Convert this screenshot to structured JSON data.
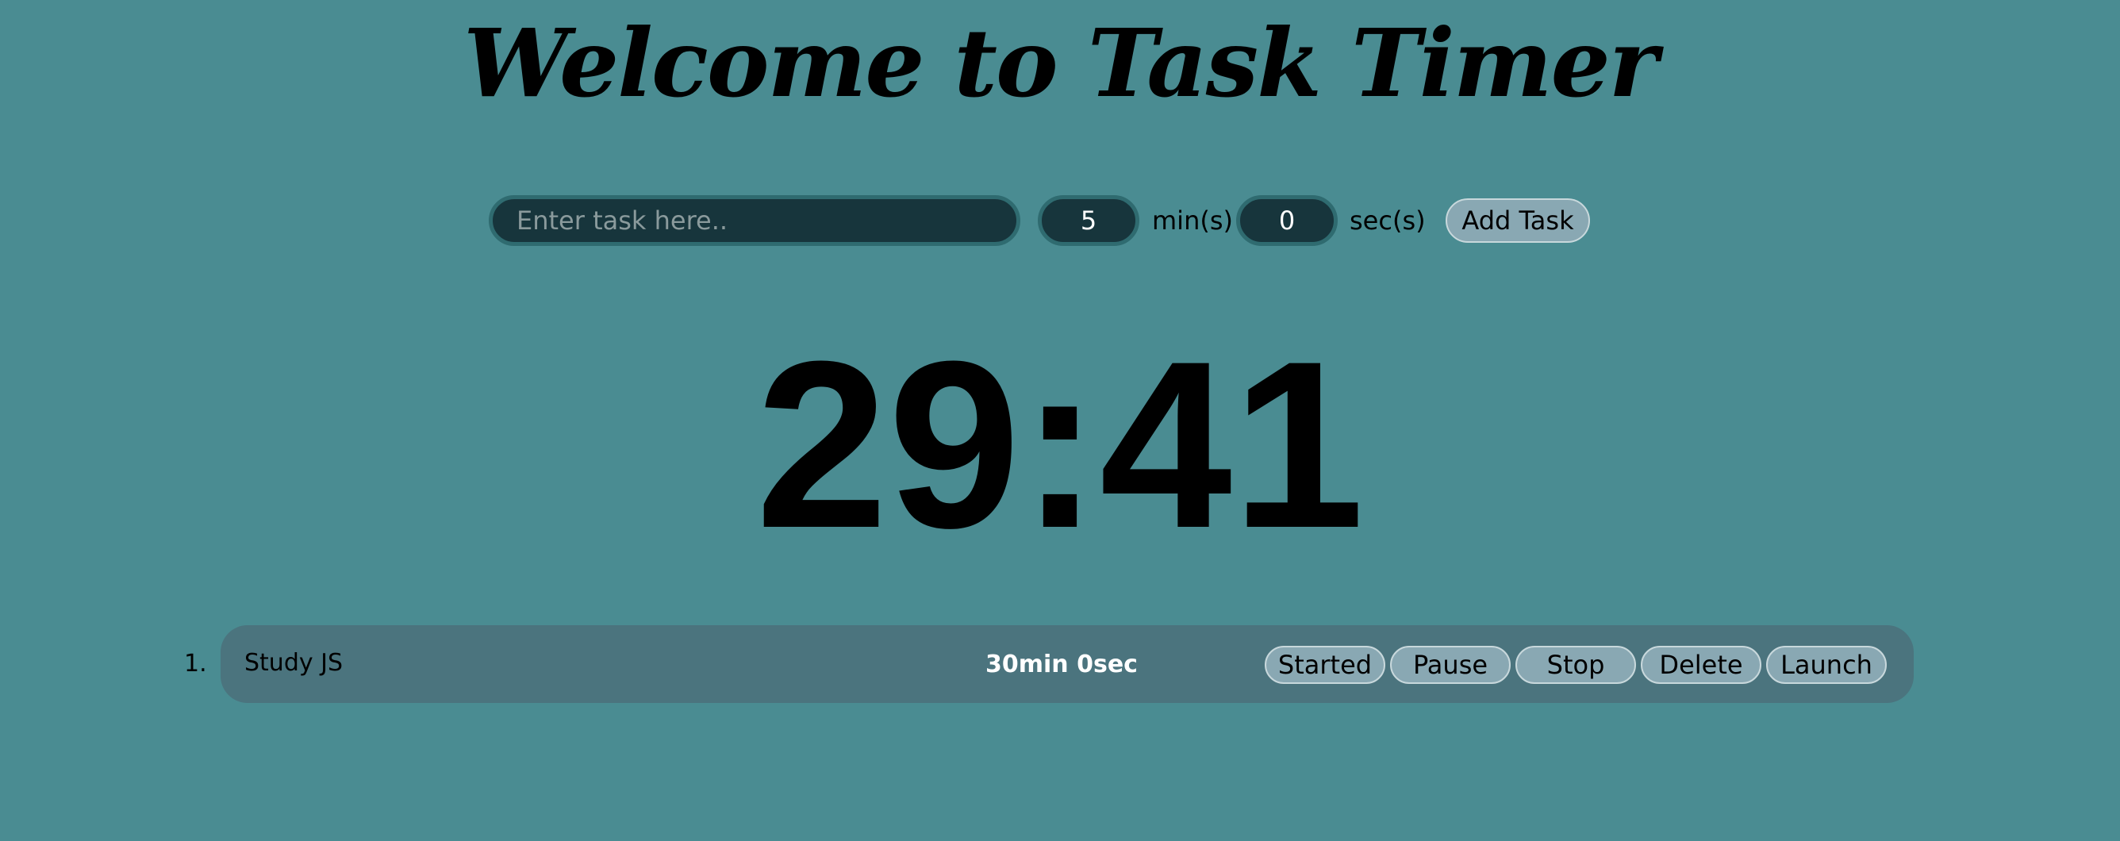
{
  "header": {
    "title": "Welcome to Task Timer"
  },
  "form": {
    "task_placeholder": "Enter task here..",
    "minutes_value": "5",
    "minutes_unit": "min(s)",
    "seconds_value": "0",
    "seconds_unit": "sec(s)",
    "add_label": "Add Task"
  },
  "timer": {
    "display": "29:41"
  },
  "tasks": [
    {
      "number": "1.",
      "name": "Study JS",
      "duration": "30min 0sec",
      "buttons": {
        "started": "Started",
        "pause": "Pause",
        "stop": "Stop",
        "delete": "Delete",
        "launch": "Launch"
      }
    }
  ],
  "colors": {
    "background": "#4a8c92",
    "input_bg": "#17353c",
    "input_border": "#2f6b70",
    "task_row_bg": "#4b747e",
    "button_bg": "#89a8b3"
  }
}
